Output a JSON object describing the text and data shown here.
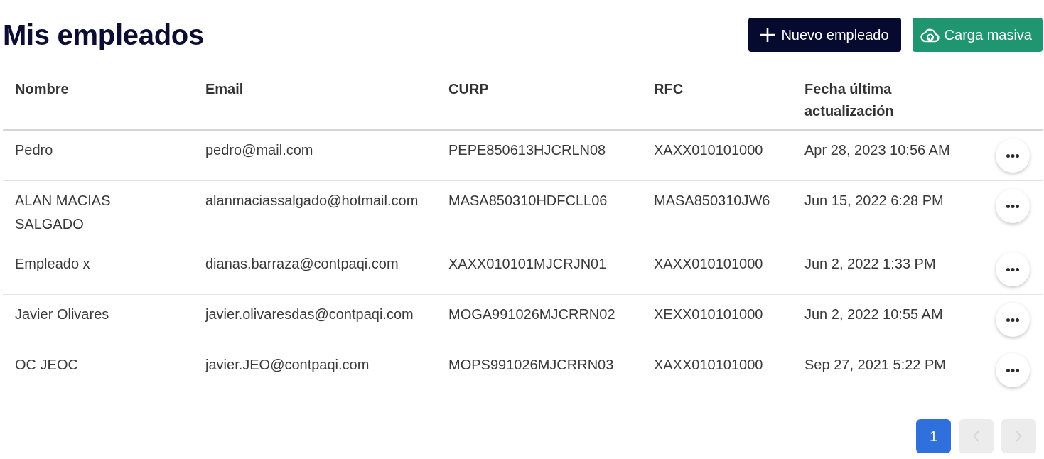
{
  "page": {
    "title": "Mis empleados"
  },
  "actions": [
    {
      "kind": "new",
      "label": "Nuevo empleado"
    },
    {
      "kind": "upload",
      "label": "Carga masiva"
    }
  ],
  "table": {
    "columns": [
      "Nombre",
      "Email",
      "CURP",
      "RFC",
      "Fecha última actualización"
    ],
    "rows": [
      {
        "cells": [
          "Pedro",
          "pedro@mail.com",
          "PEPE850613HJCRLN08",
          "XAXX010101000",
          "Apr 28, 2023 10:56 AM"
        ]
      },
      {
        "cells": [
          "ALAN MACIAS SALGADO",
          "alanmaciassalgado@hotmail.com",
          "MASA850310HDFCLL06",
          "MASA850310JW6",
          "Jun 15, 2022 6:28 PM"
        ]
      },
      {
        "cells": [
          "Empleado x",
          "dianas.barraza@contpaqi.com",
          "XAXX010101MJCRJN01",
          "XAXX010101000",
          "Jun 2, 2022 1:33 PM"
        ]
      },
      {
        "cells": [
          "Javier Olivares",
          "javier.olivaresdas@contpaqi.com",
          "MOGA991026MJCRRN02",
          "XEXX010101000",
          "Jun 2, 2022 10:55 AM"
        ]
      },
      {
        "cells": [
          "OC JEOC",
          "javier.JEO@contpaqi.com",
          "MOPS991026MJCRRN03",
          "XAXX010101000",
          "Sep 27, 2021 5:22 PM"
        ]
      }
    ]
  },
  "pagination": {
    "pages": [
      {
        "label": "1",
        "selected": true
      }
    ],
    "prev": {
      "disabled": true
    },
    "next": {
      "disabled": true
    }
  }
}
